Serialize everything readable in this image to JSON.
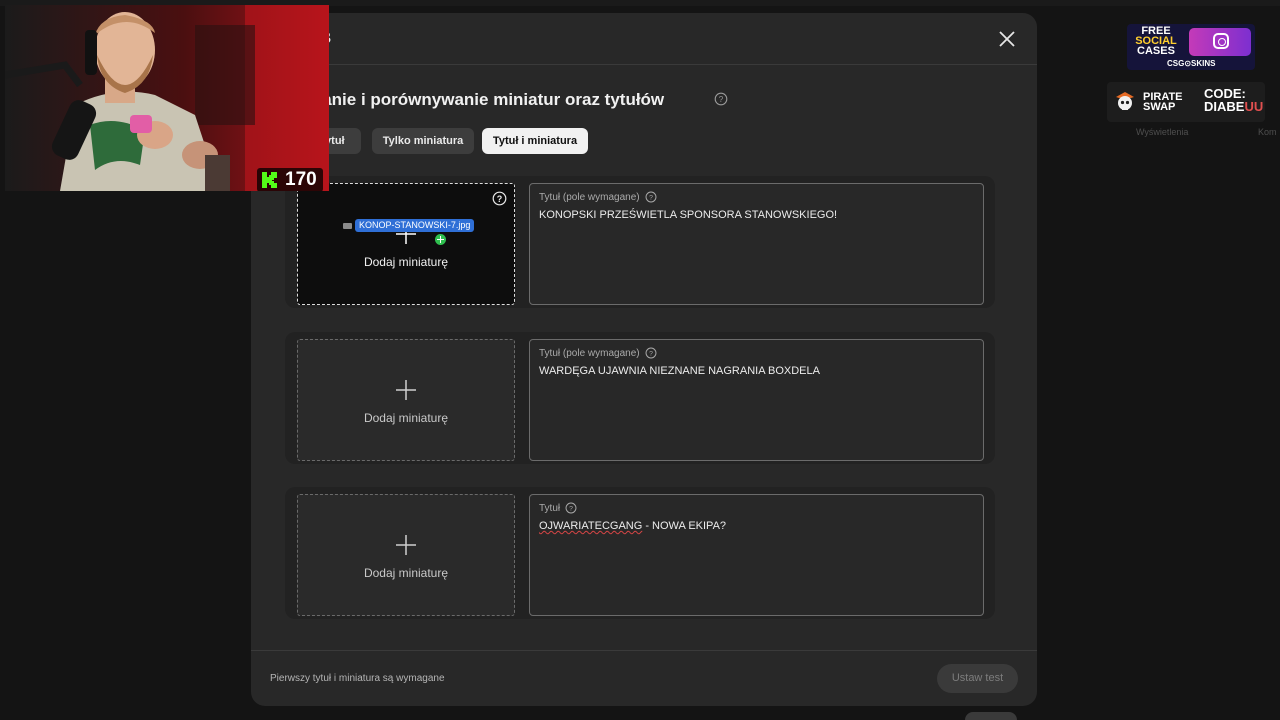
{
  "modal": {
    "title": "VB",
    "heading": "wanie i porównywanie miniatur oraz tytułów",
    "close_icon": "close-icon"
  },
  "mode_tabs": [
    {
      "label": "tytuł",
      "selected": false
    },
    {
      "label": "Tylko miniatura",
      "selected": false
    },
    {
      "label": "Tytuł i miniatura",
      "selected": true
    }
  ],
  "variants": [
    {
      "thumbnail_label": "Dodaj miniaturę",
      "title_label": "Tytuł (pole wymagane)",
      "title_value": "KONOPSKI PRZEŚWIETLA SPONSORA STANOWSKIEGO!",
      "dragging_file": "KONOP-STANOWSKI-7.jpg"
    },
    {
      "thumbnail_label": "Dodaj miniaturę",
      "title_label": "Tytuł (pole wymagane)",
      "title_value": "WARDĘGA UJAWNIA NIEZNANE NAGRANIA BOXDELA"
    },
    {
      "thumbnail_label": "Dodaj miniaturę",
      "title_label": "Tytuł",
      "title_value_misspelled": "OJWARIATECGANG",
      "title_value_rest": " - NOWA EKIPA?"
    }
  ],
  "footer": {
    "note": "Pierwszy tytuł i miniatura są wymagane",
    "set_test_label": "Ustaw test"
  },
  "stream_overlay": {
    "viewer_count": "170",
    "sponsor_1": {
      "lines": [
        "FREE",
        "SOCIAL",
        "CASES"
      ],
      "brand": "CSG⊙SKINS"
    },
    "sponsor_2": {
      "pirate_1": "PIRATE",
      "pirate_2": "SWAP",
      "code_1": "CODE:",
      "code_2a": "DIABE",
      "code_2b": "UU"
    }
  },
  "background": {
    "label_views": "Wyświetlenia",
    "label_partial": "Kom"
  },
  "colors": {
    "modal_bg": "#282828",
    "selected_tab": "#f1f1f1",
    "drag_chip": "#2f6fd6",
    "drag_add": "#2fbf4f"
  }
}
